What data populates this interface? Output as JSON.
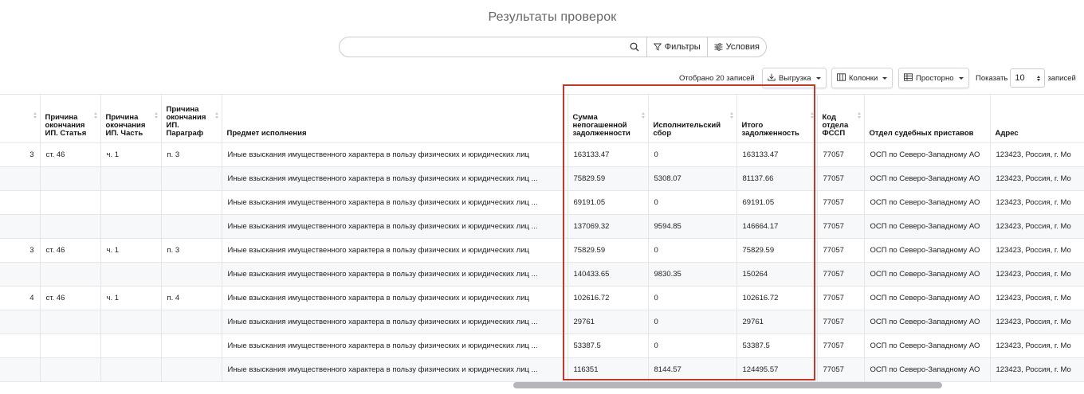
{
  "page": {
    "title": "Результаты проверок"
  },
  "search": {
    "placeholder": "",
    "value": "",
    "filters_label": "Фильтры",
    "conditions_label": "Условия"
  },
  "toolbar": {
    "selected_text": "Отобрано 20 записей",
    "export_label": "Выгрузка",
    "columns_label": "Колонки",
    "density_label": "Просторно",
    "show_label": "Показать",
    "page_length": "10",
    "records_label": "записей"
  },
  "table": {
    "columns": [
      "",
      "Причина окончания ИП. Статья",
      "Причина окончания ИП. Часть",
      "Причина окончания ИП. Параграф",
      "Предмет исполнения",
      "Сумма непогашенной задолженности",
      "Исполнительский сбор",
      "Итого задолженность",
      "Код отдела ФССП",
      "Отдел судебных приставов",
      "Адрес"
    ],
    "rows": [
      [
        "3",
        "ст. 46",
        "ч. 1",
        "п. 3",
        "Иные взыскания имущественного характера в пользу физических и юридических лиц",
        "163133.47",
        "0",
        "163133.47",
        "77057",
        "ОСП по Северо-Западному АО",
        "123423, Россия, г. Мо"
      ],
      [
        "",
        "",
        "",
        "",
        "Иные взыскания имущественного характера в пользу физических и юридических лиц ...",
        "75829.59",
        "5308.07",
        "81137.66",
        "77057",
        "ОСП по Северо-Западному АО",
        "123423, Россия, г. Мо"
      ],
      [
        "",
        "",
        "",
        "",
        "Иные взыскания имущественного характера в пользу физических и юридических лиц ...",
        "69191.05",
        "0",
        "69191.05",
        "77057",
        "ОСП по Северо-Западному АО",
        "123423, Россия, г. Мо"
      ],
      [
        "",
        "",
        "",
        "",
        "Иные взыскания имущественного характера в пользу физических и юридических лиц ...",
        "137069.32",
        "9594.85",
        "146664.17",
        "77057",
        "ОСП по Северо-Западному АО",
        "123423, Россия, г. Мо"
      ],
      [
        "3",
        "ст. 46",
        "ч. 1",
        "п. 3",
        "Иные взыскания имущественного характера в пользу физических и юридических лиц",
        "75829.59",
        "0",
        "75829.59",
        "77057",
        "ОСП по Северо-Западному АО",
        "123423, Россия, г. Мо"
      ],
      [
        "",
        "",
        "",
        "",
        "Иные взыскания имущественного характера в пользу физических и юридических лиц ...",
        "140433.65",
        "9830.35",
        "150264",
        "77057",
        "ОСП по Северо-Западному АО",
        "123423, Россия, г. Мо"
      ],
      [
        "4",
        "ст. 46",
        "ч. 1",
        "п. 4",
        "Иные взыскания имущественного характера в пользу физических и юридических лиц",
        "102616.72",
        "0",
        "102616.72",
        "77057",
        "ОСП по Северо-Западному АО",
        "123423, Россия, г. Мо"
      ],
      [
        "",
        "",
        "",
        "",
        "Иные взыскания имущественного характера в пользу физических и юридических лиц ...",
        "29761",
        "0",
        "29761",
        "77057",
        "ОСП по Северо-Западному АО",
        "123423, Россия, г. Мо"
      ],
      [
        "",
        "",
        "",
        "",
        "Иные взыскания имущественного характера в пользу физических и юридических лиц ...",
        "53387.5",
        "0",
        "53387.5",
        "77057",
        "ОСП по Северо-Западному АО",
        "123423, Россия, г. Мо"
      ],
      [
        "",
        "",
        "",
        "",
        "Иные взыскания имущественного характера в пользу физических и юридических лиц ...",
        "116351",
        "8144.57",
        "124495.57",
        "77057",
        "ОСП по Северо-Западному АО",
        "123423, Россия, г. Мо"
      ]
    ]
  },
  "icons": {
    "search": "search-icon",
    "filter": "filter-icon",
    "conditions": "sliders-icon",
    "export": "download-icon",
    "columns": "columns-icon",
    "density": "table-icon"
  },
  "colors": {
    "highlight": "#c0392b",
    "scroll_thumb": "#b5b6ba"
  }
}
